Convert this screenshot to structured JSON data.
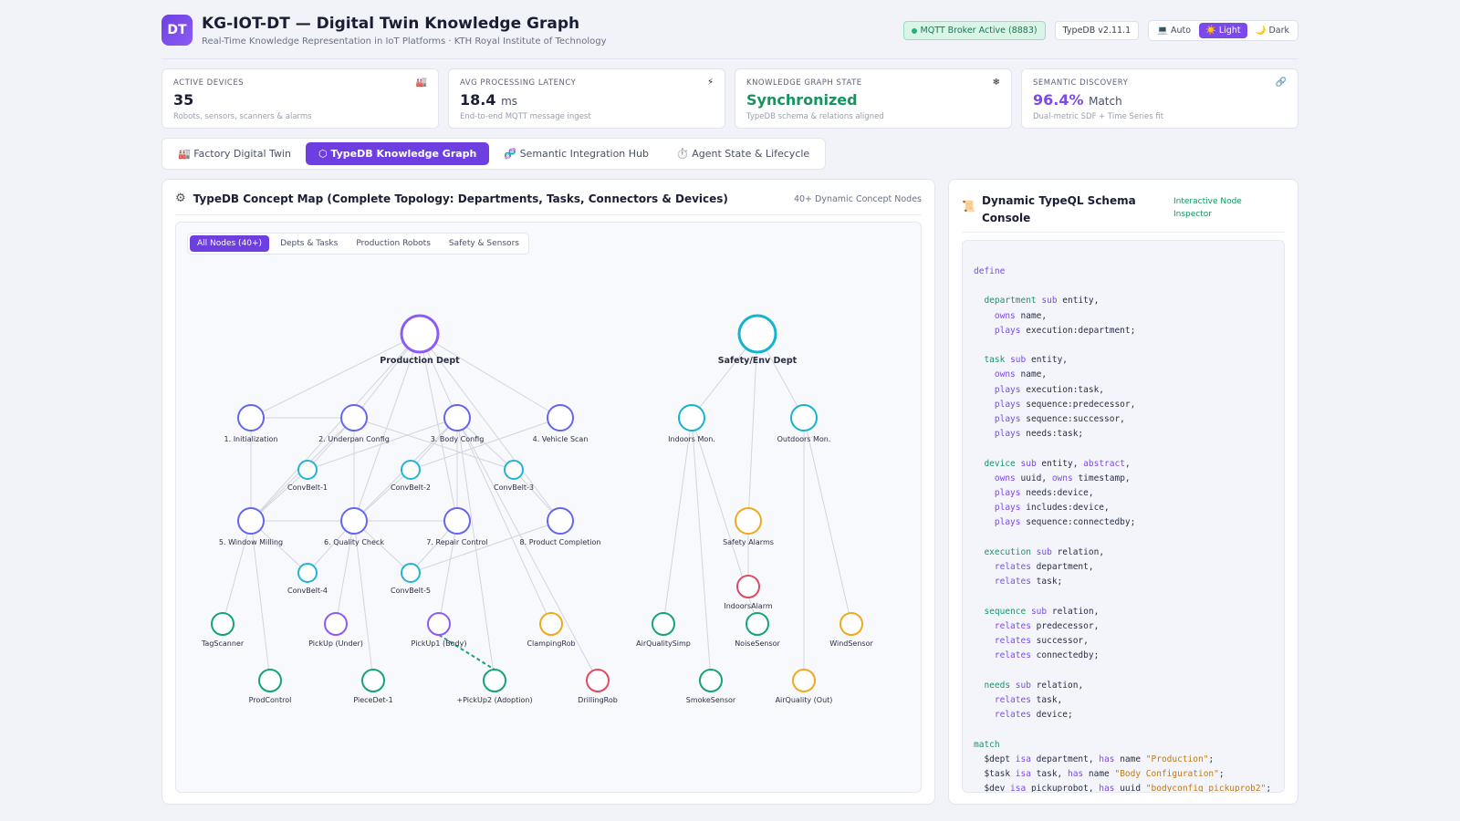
{
  "header": {
    "logo": "DT",
    "title": "KG-IOT-DT — Digital Twin Knowledge Graph",
    "subtitle": "Real-Time Knowledge Representation in IoT Platforms · KTH Royal Institute of Technology",
    "mqtt_badge": "MQTT Broker Active (8883)",
    "version_badge": "TypeDB v2.11.1",
    "theme": {
      "auto": "💻 Auto",
      "light": "☀️ Light",
      "dark": "🌙 Dark",
      "selected": "light"
    }
  },
  "stats": [
    {
      "label": "ACTIVE DEVICES",
      "icon": "🏭",
      "value": "35",
      "unit": "",
      "desc": "Robots, sensors, scanners & alarms",
      "color": "#1b1e33"
    },
    {
      "label": "AVG PROCESSING LATENCY",
      "icon": "⚡",
      "value": "18.4",
      "unit": "ms",
      "desc": "End-to-end MQTT message ingest",
      "color": "#1b1e33"
    },
    {
      "label": "KNOWLEDGE GRAPH STATE",
      "icon": "❄",
      "value": "Synchronized",
      "unit": "",
      "desc": "TypeDB schema & relations aligned",
      "color": "#14955f"
    },
    {
      "label": "SEMANTIC DISCOVERY",
      "icon": "🔗",
      "value": "96.4%",
      "unit": "Match",
      "desc": "Dual-metric SDF + Time Series fit",
      "color": "#7c4ae8"
    }
  ],
  "tabs": [
    {
      "label": "🏭 Factory Digital Twin",
      "active": false
    },
    {
      "label": "⬡ TypeDB Knowledge Graph",
      "active": true
    },
    {
      "label": "🧬 Semantic Integration Hub",
      "active": false
    },
    {
      "label": "⏱️ Agent State & Lifecycle",
      "active": false
    }
  ],
  "graph_panel": {
    "title": "TypeDB Concept Map (Complete Topology: Departments, Tasks, Connectors & Devices)",
    "count": "40+ Dynamic Concept Nodes",
    "filters": [
      {
        "label": "All Nodes (40+)",
        "active": true
      },
      {
        "label": "Depts & Tasks",
        "active": false
      },
      {
        "label": "Production Robots",
        "active": false
      },
      {
        "label": "Safety & Sensors",
        "active": false
      }
    ]
  },
  "graph": {
    "colors": {
      "dept": "#8b5cf6",
      "task": "#6366f1",
      "connector": "#22b3d6",
      "device_green": "#16a37a",
      "device_purple": "#8b5cf6",
      "device_orange": "#f0a81e",
      "device_red": "#e04a64",
      "safety_dept": "#14b3cf"
    },
    "nodes": [
      {
        "id": "prod",
        "label": "Production Dept",
        "type": "dept",
        "color": "dept"
      },
      {
        "id": "safe",
        "label": "Safety/Env Dept",
        "type": "dept",
        "color": "safety_dept"
      },
      {
        "id": "t1",
        "label": "1. Initialization",
        "type": "task",
        "color": "task"
      },
      {
        "id": "t2",
        "label": "2. Underpan Config",
        "type": "task",
        "color": "task"
      },
      {
        "id": "t3",
        "label": "3. Body Config",
        "type": "task",
        "color": "task"
      },
      {
        "id": "t4",
        "label": "4. Vehicle Scan",
        "type": "task",
        "color": "task"
      },
      {
        "id": "c1",
        "label": "ConvBelt-1",
        "type": "conn",
        "color": "connector"
      },
      {
        "id": "c2",
        "label": "ConvBelt-2",
        "type": "conn",
        "color": "connector"
      },
      {
        "id": "c3",
        "label": "ConvBelt-3",
        "type": "conn",
        "color": "connector"
      },
      {
        "id": "t5",
        "label": "5. Window Milling",
        "type": "task",
        "color": "task"
      },
      {
        "id": "t6",
        "label": "6. Quality Check",
        "type": "task",
        "color": "task"
      },
      {
        "id": "t7",
        "label": "7. Repair Control",
        "type": "task",
        "color": "task"
      },
      {
        "id": "t8",
        "label": "8. Product Completion",
        "type": "task",
        "color": "task"
      },
      {
        "id": "c4",
        "label": "ConvBelt-4",
        "type": "conn",
        "color": "connector"
      },
      {
        "id": "c5",
        "label": "ConvBelt-5",
        "type": "conn",
        "color": "connector"
      },
      {
        "id": "tag",
        "label": "TagScanner",
        "type": "dev",
        "color": "device_green"
      },
      {
        "id": "puu",
        "label": "PickUp (Under)",
        "type": "dev",
        "color": "device_purple"
      },
      {
        "id": "pu1",
        "label": "PickUp1 (Body)",
        "type": "dev",
        "color": "device_purple"
      },
      {
        "id": "clamp",
        "label": "ClampingRob",
        "type": "dev",
        "color": "device_orange"
      },
      {
        "id": "pc",
        "label": "ProdControl",
        "type": "dev",
        "color": "device_green"
      },
      {
        "id": "pd1",
        "label": "PieceDet-1",
        "type": "dev",
        "color": "device_green"
      },
      {
        "id": "pu2",
        "label": "+PickUp2 (Adoption)",
        "type": "dev",
        "color": "device_green"
      },
      {
        "id": "drill",
        "label": "DrillingRob",
        "type": "dev",
        "color": "device_red"
      },
      {
        "id": "indm",
        "label": "Indoors Mon.",
        "type": "task",
        "color": "safety_dept"
      },
      {
        "id": "outm",
        "label": "Outdoors Mon.",
        "type": "task",
        "color": "safety_dept"
      },
      {
        "id": "salarm",
        "label": "Safety Alarms",
        "type": "task",
        "color": "device_orange"
      },
      {
        "id": "ialarm",
        "label": "IndoorsAlarm",
        "type": "dev",
        "color": "device_red"
      },
      {
        "id": "aqs",
        "label": "AirQualitySimp",
        "type": "dev",
        "color": "device_green"
      },
      {
        "id": "noise",
        "label": "NoiseSensor",
        "type": "dev",
        "color": "device_green"
      },
      {
        "id": "wind",
        "label": "WindSensor",
        "type": "dev",
        "color": "device_orange"
      },
      {
        "id": "smoke",
        "label": "SmokeSensor",
        "type": "dev",
        "color": "device_green"
      },
      {
        "id": "aqo",
        "label": "AirQuality (Out)",
        "type": "dev",
        "color": "device_orange"
      }
    ],
    "edges": [
      [
        "prod",
        "t1"
      ],
      [
        "prod",
        "t2"
      ],
      [
        "prod",
        "t3"
      ],
      [
        "prod",
        "t4"
      ],
      [
        "prod",
        "t5"
      ],
      [
        "prod",
        "t6"
      ],
      [
        "prod",
        "t7"
      ],
      [
        "prod",
        "t8"
      ],
      [
        "t1",
        "t2"
      ],
      [
        "t2",
        "c1"
      ],
      [
        "t3",
        "c1"
      ],
      [
        "t3",
        "c2"
      ],
      [
        "t4",
        "c2"
      ],
      [
        "t2",
        "c3"
      ],
      [
        "t3",
        "c3"
      ],
      [
        "t1",
        "t5"
      ],
      [
        "t2",
        "t5"
      ],
      [
        "t2",
        "t6"
      ],
      [
        "t3",
        "t6"
      ],
      [
        "t3",
        "t7"
      ],
      [
        "c1",
        "t5"
      ],
      [
        "c2",
        "t6"
      ],
      [
        "c3",
        "t8"
      ],
      [
        "t5",
        "t6"
      ],
      [
        "t6",
        "t7"
      ],
      [
        "t5",
        "c4"
      ],
      [
        "t6",
        "c4"
      ],
      [
        "t6",
        "c5"
      ],
      [
        "t7",
        "c5"
      ],
      [
        "t8",
        "c5"
      ],
      [
        "t5",
        "tag"
      ],
      [
        "t5",
        "pc"
      ],
      [
        "t6",
        "puu"
      ],
      [
        "t6",
        "pd1"
      ],
      [
        "t7",
        "pu1"
      ],
      [
        "t3",
        "pu2"
      ],
      [
        "t3",
        "drill"
      ],
      [
        "t3",
        "clamp"
      ],
      [
        "safe",
        "indm"
      ],
      [
        "safe",
        "outm"
      ],
      [
        "safe",
        "salarm"
      ],
      [
        "indm",
        "aqs"
      ],
      [
        "indm",
        "smoke"
      ],
      [
        "indm",
        "noise"
      ],
      [
        "salarm",
        "ialarm"
      ],
      [
        "outm",
        "aqo"
      ],
      [
        "outm",
        "wind"
      ]
    ],
    "dashed_edge": [
      "pu1",
      "pu2"
    ]
  },
  "schema_panel": {
    "title": "Dynamic TypeQL Schema Console",
    "inspector": "Interactive Node Inspector"
  }
}
